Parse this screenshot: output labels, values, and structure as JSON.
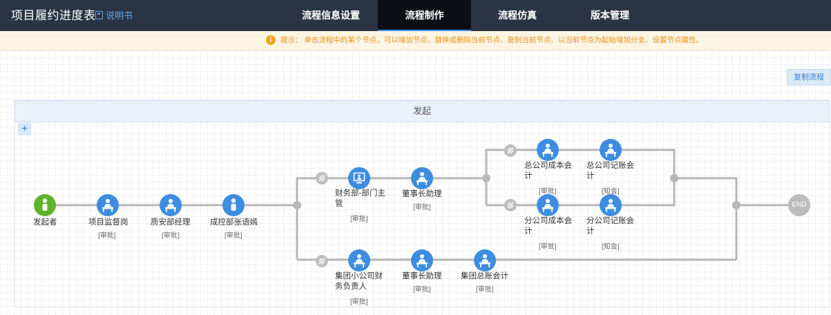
{
  "header": {
    "title": "项目履约进度表",
    "manual": "说明书",
    "tabs": [
      "流程信息设置",
      "流程制作",
      "流程仿真",
      "版本管理"
    ],
    "active_tab": "流程制作"
  },
  "tip": {
    "icon": "info-icon",
    "label": "提示：",
    "text": "单击流程中的某个节点，可以增加节点、替换或删除当前节点、复制当前节点、以当前节点为起始增加分支、设置节点属性。"
  },
  "toolbar": {
    "copy_flow": "复制流程"
  },
  "start_bar": "发起",
  "add_symbol": "+",
  "end_label": "END",
  "nodes": {
    "initiator": {
      "name": "发起者",
      "tag": ""
    },
    "supervisor": {
      "name": "项目监督岗",
      "tag": "[审批]"
    },
    "quality": {
      "name": "质安部经理",
      "tag": "[审批]"
    },
    "cost_control": {
      "name": "成控部张语嫣",
      "tag": "[审批]"
    },
    "finance_head": {
      "name": "财务部-部门主管",
      "tag": "[审批]"
    },
    "chairman_asst_1": {
      "name": "董事长助理",
      "tag": "[审批]"
    },
    "hq_cost_acct": {
      "name": "总公司成本会计",
      "tag": "[审批]"
    },
    "hq_book_acct": {
      "name": "总公司记账会计",
      "tag": "[知会]"
    },
    "br_cost_acct": {
      "name": "分公司成本会计",
      "tag": "[审批]"
    },
    "br_book_acct": {
      "name": "分公司记账会计",
      "tag": "[知会]"
    },
    "group_fin": {
      "name": "集团小公司财务负责人",
      "tag": "[审批]"
    },
    "chairman_asst_2": {
      "name": "董事长助理",
      "tag": "[审批]"
    },
    "group_gl": {
      "name": "集团总账会计",
      "tag": "[审批]"
    }
  },
  "colors": {
    "header_bg": "#2b3445",
    "node": "#3d8de0",
    "start_node": "#5fb32d",
    "tip_text": "#e8921c"
  }
}
